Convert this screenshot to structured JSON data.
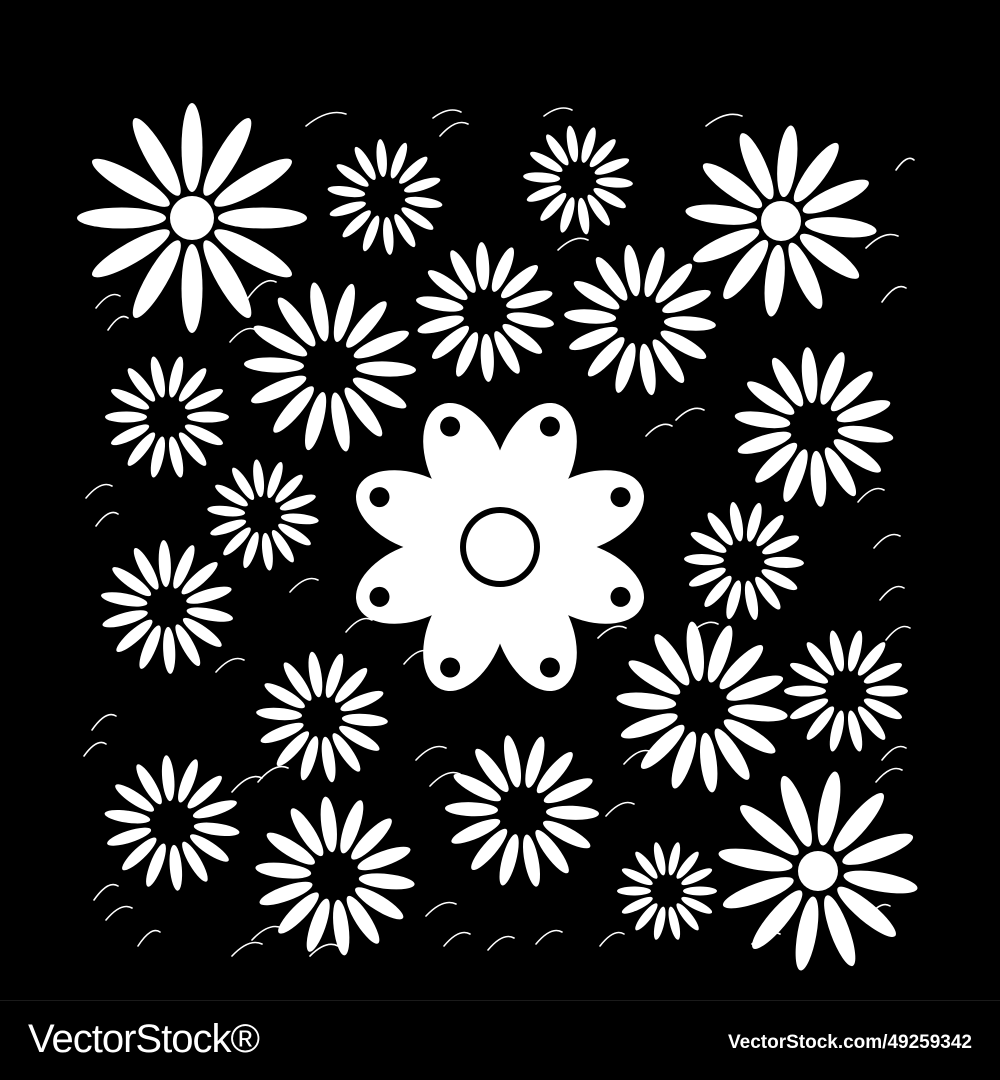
{
  "image": {
    "subject": "white daisy flowers pattern on black background",
    "background_color": "#000000",
    "foreground_color": "#ffffff"
  },
  "watermark": {
    "brand": "VectorStock",
    "trademark": "®",
    "url_text": "VectorStock.com/49259342"
  }
}
